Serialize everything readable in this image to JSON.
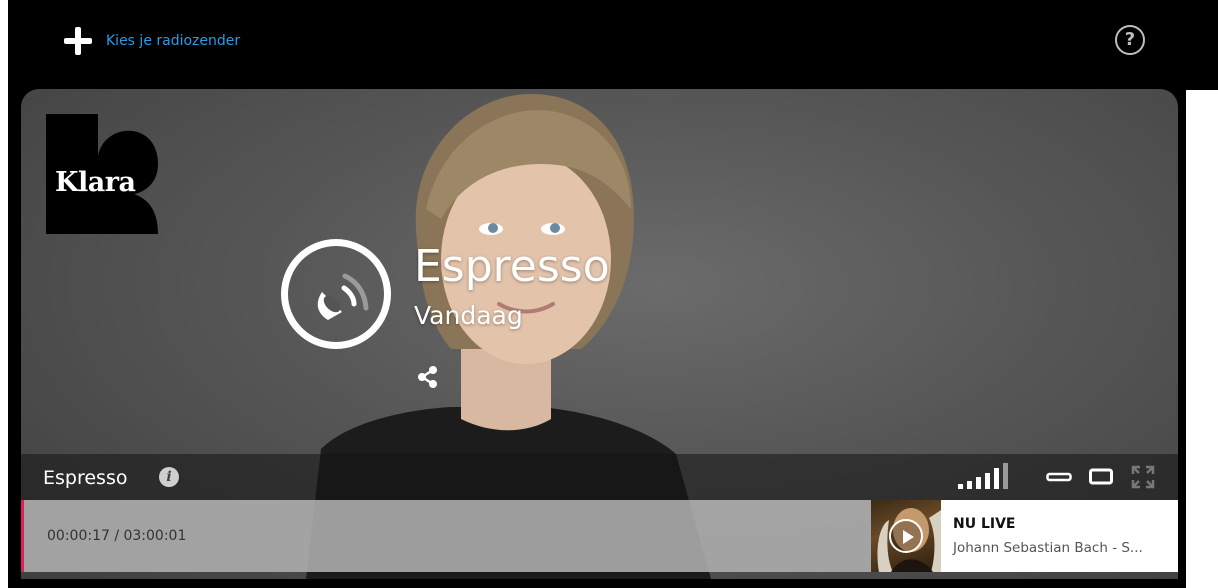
{
  "header": {
    "add_station_label": "Kies je radiozender",
    "help_label": "?"
  },
  "station": {
    "logo_text": "Klara"
  },
  "program": {
    "title": "Espresso",
    "subtitle": "Vandaag",
    "bar_name": "Espresso",
    "info_label": "i"
  },
  "timeline": {
    "time_display": "00:00:17 / 03:00:01",
    "accent_color": "#e31c5f"
  },
  "live": {
    "label": "NU LIVE",
    "track": "Johann Sebastian Bach - S..."
  },
  "icons": {
    "add": "plus-icon",
    "help": "help-icon",
    "live": "live-broadcast-icon",
    "share": "share-icon",
    "info": "info-icon",
    "signal": "signal-strength-icon",
    "size_small": "size-small-icon",
    "size_medium": "size-medium-icon",
    "fullscreen": "fullscreen-icon",
    "play": "play-icon"
  },
  "colors": {
    "link": "#2a9be8",
    "background": "#000000"
  }
}
